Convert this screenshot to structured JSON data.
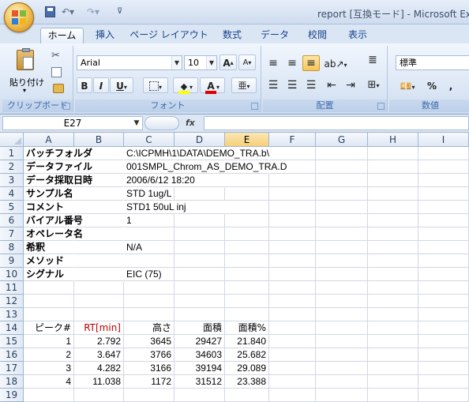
{
  "window": {
    "title": "report [互換モード] - Microsoft Excel"
  },
  "tabs": [
    {
      "label": "ホーム",
      "active": true
    },
    {
      "label": "挿入",
      "active": false
    },
    {
      "label": "ページ レイアウト",
      "active": false
    },
    {
      "label": "数式",
      "active": false
    },
    {
      "label": "データ",
      "active": false
    },
    {
      "label": "校閲",
      "active": false
    },
    {
      "label": "表示",
      "active": false
    }
  ],
  "ribbon": {
    "clipboard": {
      "label": "クリップボード",
      "paste_label": "貼り付け"
    },
    "font": {
      "label": "フォント",
      "font_name": "Arial",
      "font_size": "10",
      "bold": "B",
      "italic": "I",
      "underline": "U",
      "grow": "A",
      "shrink": "A"
    },
    "alignment": {
      "label": "配置"
    },
    "number": {
      "label": "数値",
      "format": "標準",
      "percent": "%",
      "comma": ","
    }
  },
  "formula_bar": {
    "name_box": "E27",
    "fx": "fx",
    "formula": ""
  },
  "sheet": {
    "columns": [
      "A",
      "B",
      "C",
      "D",
      "E",
      "F",
      "G",
      "H",
      "I"
    ],
    "selected_column": "E",
    "rows": [
      {
        "n": "1",
        "a": "バッチフォルダ",
        "c": "C:\\ICPMH\\1\\DATA\\DEMO_TRA.b\\"
      },
      {
        "n": "2",
        "a": "データファイル",
        "c": "001SMPL_Chrom_AS_DEMO_TRA.D"
      },
      {
        "n": "3",
        "a": "データ採取日時",
        "c": "2006/6/12 18:20"
      },
      {
        "n": "4",
        "a": "サンプル名",
        "c": "STD 1ug/L"
      },
      {
        "n": "5",
        "a": "コメント",
        "c": "STD1 50uL inj"
      },
      {
        "n": "6",
        "a": "バイアル番号",
        "c": "1"
      },
      {
        "n": "7",
        "a": "オペレータ名",
        "c": ""
      },
      {
        "n": "8",
        "a": "希釈",
        "c": "N/A"
      },
      {
        "n": "9",
        "a": "メソッド",
        "c": ""
      },
      {
        "n": "10",
        "a": "シグナル",
        "c": "EIC (75)"
      },
      {
        "n": "11"
      },
      {
        "n": "12"
      },
      {
        "n": "13"
      }
    ],
    "table_header": {
      "n": "14",
      "a": "ピーク#",
      "b": "RT[min]",
      "c": "高さ",
      "d": "面積",
      "e": "面積%"
    },
    "table_rows": [
      {
        "n": "15",
        "a": "1",
        "b": "2.792",
        "c": "3645",
        "d": "29427",
        "e": "21.840"
      },
      {
        "n": "16",
        "a": "2",
        "b": "3.647",
        "c": "3766",
        "d": "34603",
        "e": "25.682"
      },
      {
        "n": "17",
        "a": "3",
        "b": "4.282",
        "c": "3166",
        "d": "39194",
        "e": "29.089"
      },
      {
        "n": "18",
        "a": "4",
        "b": "11.038",
        "c": "1172",
        "d": "31512",
        "e": "23.388"
      }
    ],
    "empty_rows": [
      "19"
    ]
  },
  "colors": {
    "accent": "#15428b",
    "ribbon": "#dde8f6",
    "selected_column": "#f6cf79",
    "rt_header": "#c00000"
  }
}
